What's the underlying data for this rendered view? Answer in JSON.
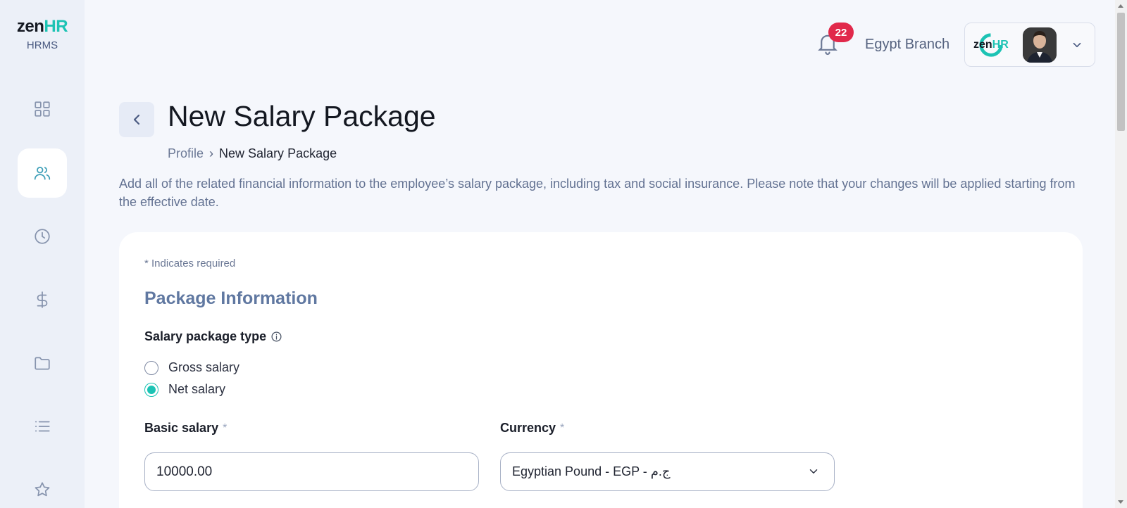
{
  "sidebar": {
    "logo_main": "zen",
    "logo_accent": "HR",
    "logo_sub": "HRMS",
    "items": [
      {
        "icon": "dashboard-grid-icon",
        "active": false
      },
      {
        "icon": "users-icon",
        "active": true
      },
      {
        "icon": "clock-icon",
        "active": false
      },
      {
        "icon": "dollar-icon",
        "active": false
      },
      {
        "icon": "folder-icon",
        "active": false
      },
      {
        "icon": "list-icon",
        "active": false
      },
      {
        "icon": "star-icon",
        "active": false
      }
    ]
  },
  "header": {
    "notification_count": "22",
    "branch": "Egypt Branch",
    "account_logo_main": "zen",
    "account_logo_accent": "HR"
  },
  "page": {
    "title": "New Salary Package",
    "breadcrumb": {
      "parent": "Profile",
      "separator": "›",
      "current": "New Salary Package"
    },
    "intro": "Add all of the related financial information to the employee’s salary package, including tax and social insurance. Please note that your changes will be applied starting from the effective date."
  },
  "form": {
    "required_note": "* Indicates required",
    "section_title": "Package Information",
    "package_type": {
      "label": "Salary package type",
      "options": [
        {
          "label": "Gross salary",
          "checked": false
        },
        {
          "label": "Net salary",
          "checked": true
        }
      ]
    },
    "basic_salary": {
      "label": "Basic salary",
      "required_mark": "*",
      "value": "10000.00"
    },
    "currency": {
      "label": "Currency",
      "required_mark": "*",
      "value": "Egyptian Pound - EGP - ج.م"
    }
  },
  "colors": {
    "accent": "#1cc3b4",
    "badge": "#e1294b",
    "section": "#6078a1",
    "sidebar_bg": "#ecf0f8"
  }
}
